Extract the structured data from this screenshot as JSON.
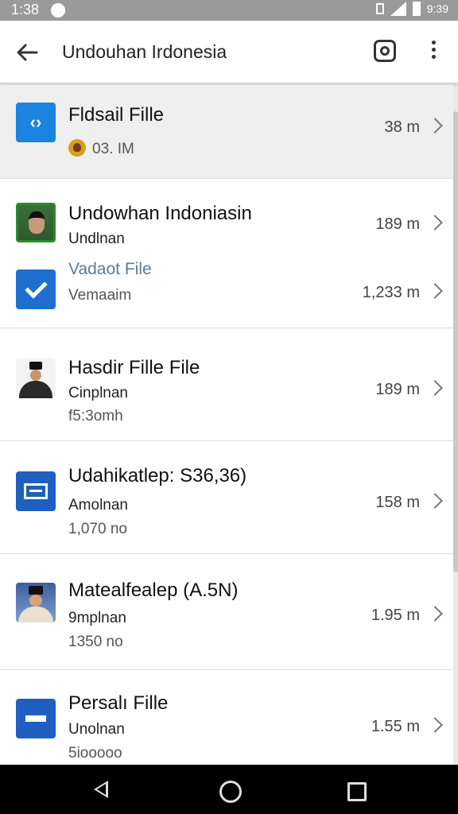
{
  "status_bar": {
    "time": "1:38",
    "right_text": "9:39"
  },
  "app_bar": {
    "title": "Undouhan Irdonesia"
  },
  "items": [
    {
      "title": "Fldsail Fille",
      "subtitle": "03. IM",
      "size": "38 m"
    },
    {
      "title": "Undowhan Indoniasin",
      "subtitle": "Undlnan",
      "size": "189 m"
    },
    {
      "title": "Vadaot File",
      "subtitle": "Vemaaim",
      "size": "1,233 m"
    },
    {
      "title": "Hasdir Fille File",
      "subtitle": "Cinplnan",
      "meta": "f5:3omh",
      "size": "189 m"
    },
    {
      "title": "Udahikatlep: S36,36)",
      "subtitle": "Amolnan",
      "meta": "1,070 no",
      "size": "158 m"
    },
    {
      "title": "Matealfealep (A.5N)",
      "subtitle": "9mplnan",
      "meta": "1350 no",
      "size": "1.95 m"
    },
    {
      "title": "Persalı Fille",
      "subtitle": "Unolnan",
      "meta": "5iooooo",
      "size": "1.55 m"
    }
  ],
  "colors": {
    "accent_blue": "#1a84e0",
    "doc_blue": "#1e5fc0",
    "link_text": "#5b7a92"
  },
  "icons": [
    "code-file-icon",
    "photo-icon",
    "check-icon",
    "portrait-icon",
    "document-icon",
    "portrait-icon",
    "minus-doc-icon"
  ]
}
